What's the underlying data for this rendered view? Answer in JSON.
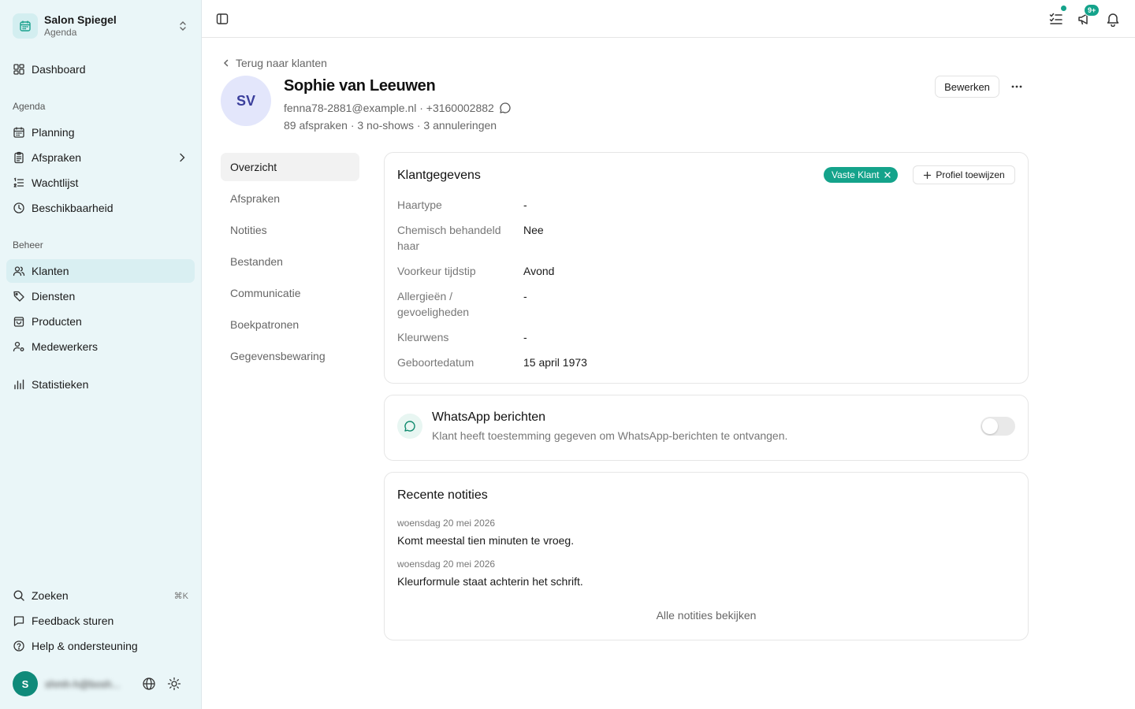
{
  "sidebar": {
    "org_name": "Salon Spiegel",
    "org_sub": "Agenda",
    "dashboard": "Dashboard",
    "group_agenda": "Agenda",
    "planning": "Planning",
    "afspraken": "Afspraken",
    "wachtlijst": "Wachtlijst",
    "beschikbaarheid": "Beschikbaarheid",
    "group_beheer": "Beheer",
    "klanten": "Klanten",
    "diensten": "Diensten",
    "producten": "Producten",
    "medewerkers": "Medewerkers",
    "statistieken": "Statistieken",
    "zoeken": "Zoeken",
    "zoeken_shortcut": "⌘K",
    "feedback": "Feedback sturen",
    "help": "Help & ondersteuning",
    "user_initial": "S",
    "user_email": "shmh-h@bosh..."
  },
  "topbar": {
    "notifications_badge": "9+"
  },
  "customer": {
    "back_label": "Terug naar klanten",
    "initials": "SV",
    "name": "Sophie van Leeuwen",
    "contact": "fenna78-2881@example.nl · +3160002882",
    "stats": "89 afspraken · 3 no-shows · 3 annuleringen",
    "edit_label": "Bewerken"
  },
  "tabs": [
    "Overzicht",
    "Afspraken",
    "Notities",
    "Bestanden",
    "Communicatie",
    "Boekpatronen",
    "Gegevensbewaring"
  ],
  "details": {
    "title": "Klantgegevens",
    "tag": "Vaste Klant",
    "assign_label": "Profiel toewijzen",
    "fields": [
      {
        "label": "Haartype",
        "value": "-"
      },
      {
        "label": "Chemisch behandeld haar",
        "value": "Nee"
      },
      {
        "label": "Voorkeur tijdstip",
        "value": "Avond"
      },
      {
        "label": "Allergieën / gevoeligheden",
        "value": "-"
      },
      {
        "label": "Kleurwens",
        "value": "-"
      },
      {
        "label": "Geboortedatum",
        "value": "15 april 1973"
      }
    ]
  },
  "whatsapp": {
    "title": "WhatsApp berichten",
    "description": "Klant heeft toestemming gegeven om WhatsApp-berichten te ontvangen.",
    "enabled": false
  },
  "notes": {
    "title": "Recente notities",
    "items": [
      {
        "date": "woensdag 20 mei 2026",
        "text": "Komt meestal tien minuten te vroeg."
      },
      {
        "date": "woensdag 20 mei 2026",
        "text": "Kleurformule staat achterin het schrift."
      }
    ],
    "all_label": "Alle notities bekijken"
  },
  "colors": {
    "accent": "#14a38b",
    "sidebar_bg": "#eaf6f8",
    "avatar_bg": "#e3e6fb"
  }
}
